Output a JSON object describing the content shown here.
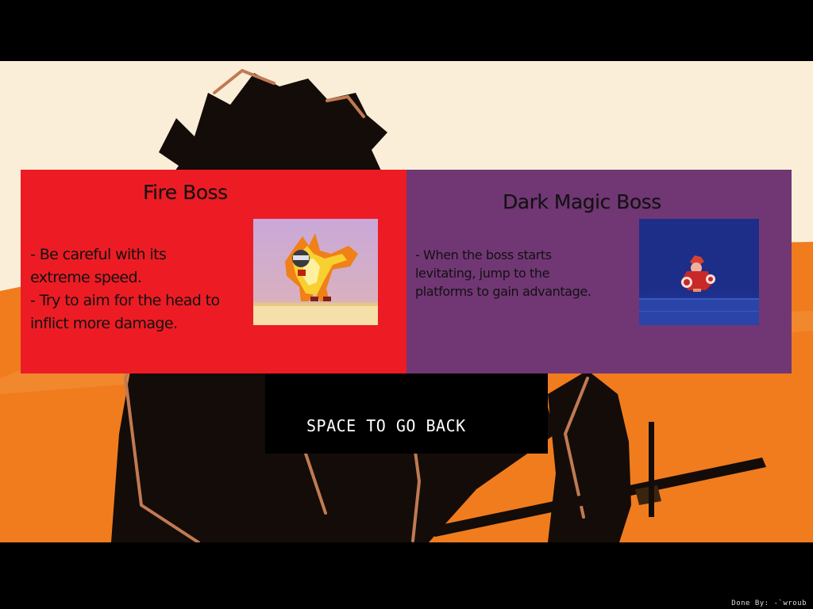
{
  "fire_boss": {
    "title": "Fire Boss",
    "tips": [
      "- Be careful with its",
      "extreme speed.",
      "- Try to aim for the head to",
      "inflict more damage."
    ],
    "panel_color": "#ed1c24",
    "icon": "fire-boss-sprite"
  },
  "dark_boss": {
    "title": "Dark Magic Boss",
    "tips": [
      "- When the boss starts",
      "levitating, jump to the",
      "platforms to gain advantage."
    ],
    "panel_color": "#713774",
    "icon": "dark-magic-boss-sprite"
  },
  "back_prompt": "SPACE TO GO BACK",
  "credit": "Done By: -`wroub",
  "colors": {
    "sky": "#fbeed9",
    "sunset_orange": "#f07c1e",
    "silhouette": "#140c08",
    "letterbox": "#000000"
  }
}
